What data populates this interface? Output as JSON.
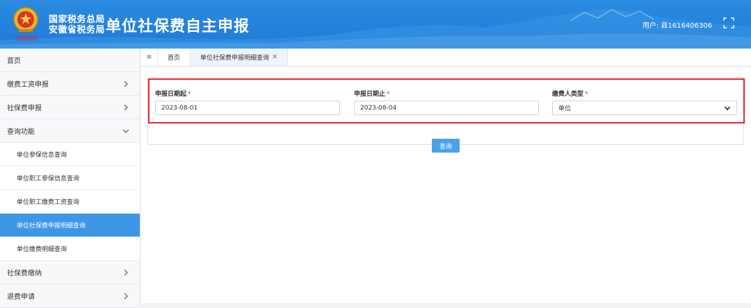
{
  "header": {
    "org_line1": "国家税务总局",
    "org_line2": "安徽省税务局",
    "app_title": "单位社保费自主申报",
    "user_text": "用户: 县1616406306"
  },
  "sidebar": {
    "items": [
      {
        "label": "首页"
      },
      {
        "label": "缴费工资申报"
      },
      {
        "label": "社保费申报"
      },
      {
        "label": "查询功能"
      },
      {
        "label": "单位参保信息查询"
      },
      {
        "label": "单位职工参保信息查询"
      },
      {
        "label": "单位职工缴费工资查询"
      },
      {
        "label": "单位社保费申报明细查询"
      },
      {
        "label": "单位缴费明细查询"
      },
      {
        "label": "社保费缴纳"
      },
      {
        "label": "退费申请"
      }
    ]
  },
  "tabs": {
    "toggle": "≡",
    "home": "首页",
    "active": "单位社保费申报明细查询",
    "close": "✕"
  },
  "form": {
    "start_label": "申报日期起",
    "start_value": "2023-08-01",
    "end_label": "申报日期止",
    "end_value": "2023-08-04",
    "type_label": "缴费人类型",
    "type_value": "单位",
    "required_mark": "*",
    "query_button": "查询"
  },
  "colors": {
    "header_blue": "#1f7ad8",
    "active_blue": "#3e96e6",
    "highlight_red": "#e3262d",
    "button_blue": "#4aa3e8"
  }
}
